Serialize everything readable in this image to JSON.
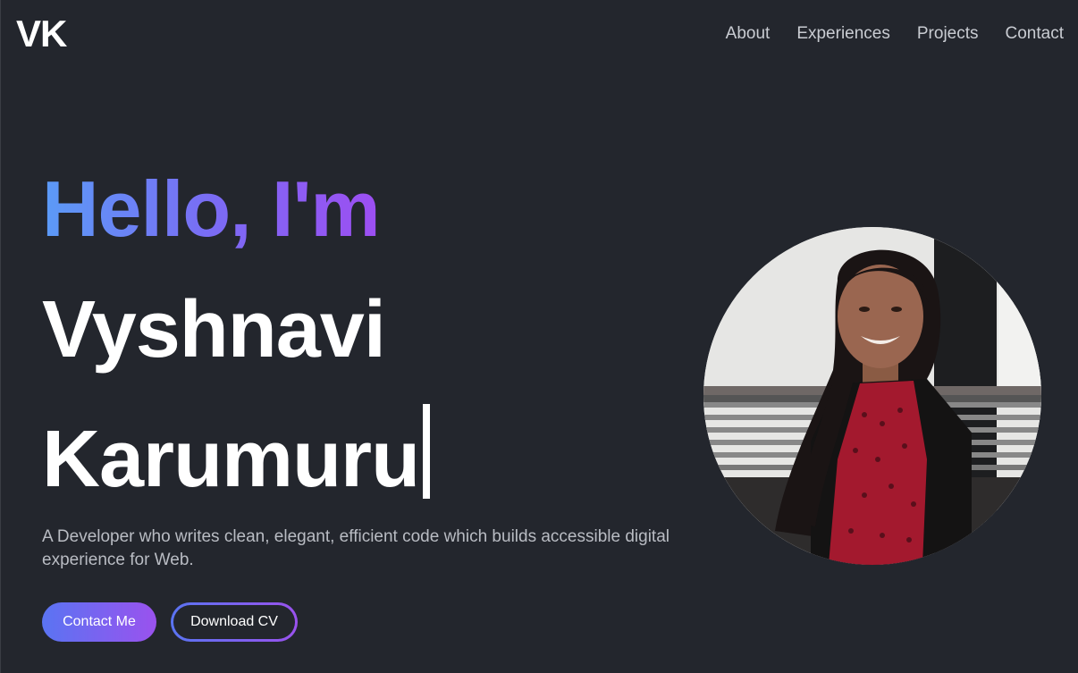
{
  "header": {
    "logo": "VK",
    "nav": [
      "About",
      "Experiences",
      "Projects",
      "Contact"
    ]
  },
  "hero": {
    "greeting": "Hello, I'm",
    "first_name": "Vyshnavi",
    "last_name": "Karumuru",
    "tagline": "A Developer who writes clean, elegant, efficient code which builds accessible digital experience for Web.",
    "primary_button": "Contact Me",
    "secondary_button": "Download CV"
  },
  "colors": {
    "background": "#23262d",
    "gradient_start": "#5b9bf7",
    "gradient_end": "#9d4ef2",
    "text_muted": "#b9bcc3"
  }
}
